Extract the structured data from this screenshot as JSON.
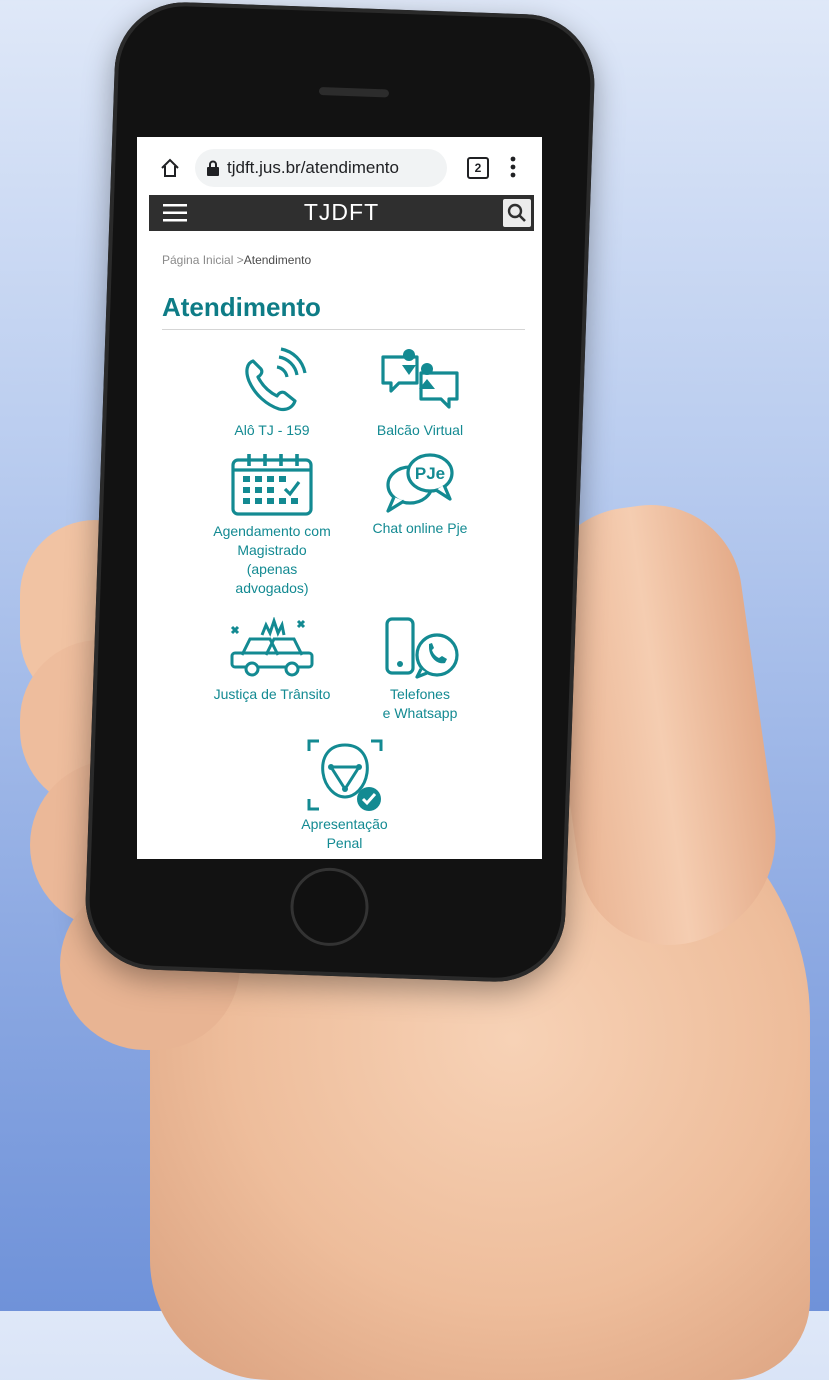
{
  "browser": {
    "url": "tjdft.jus.br/atendimento",
    "tab_count": "2"
  },
  "site": {
    "logo": "TJDFT"
  },
  "breadcrumb": {
    "home": "Página Inicial",
    "separator": ">",
    "current": "Atendimento"
  },
  "page": {
    "title": "Atendimento"
  },
  "services": [
    {
      "label": "Alô TJ - 159",
      "icon": "phone-icon"
    },
    {
      "label": "Balcão Virtual",
      "icon": "chat-users-icon"
    },
    {
      "label_lines": [
        "Agendamento com",
        "Magistrado",
        "(apenas",
        "advogados)"
      ],
      "icon": "calendar-icon"
    },
    {
      "label": "Chat online Pje",
      "icon": "pje-chat-icon"
    },
    {
      "label": "Justiça de Trânsito",
      "icon": "car-crash-icon"
    },
    {
      "label_lines": [
        "Telefones",
        "e Whatsapp"
      ],
      "icon": "whatsapp-icon"
    },
    {
      "label_lines": [
        "Apresentação",
        "Penal"
      ],
      "icon": "face-check-icon"
    }
  ],
  "colors": {
    "accent": "#138a92",
    "title": "#0e7c86",
    "header": "#2f2f2f"
  }
}
